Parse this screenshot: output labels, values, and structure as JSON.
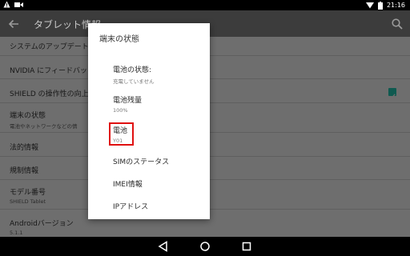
{
  "status_bar": {
    "time": "21:16",
    "icons": [
      "warning-icon",
      "media-icon",
      "wifi-icon",
      "battery-icon"
    ]
  },
  "app_bar": {
    "title": "タブレット情報"
  },
  "settings": {
    "items": [
      {
        "title": "システムのアップデート",
        "subtitle": ""
      },
      {
        "title": "NVIDIA にフィードバック",
        "subtitle": ""
      },
      {
        "title": "SHIELD の操作性の向上に",
        "subtitle": ""
      },
      {
        "title": "端末の状態",
        "subtitle": "電池やネットワークなどの情"
      },
      {
        "title": "法的情報",
        "subtitle": ""
      },
      {
        "title": "規制情報",
        "subtitle": ""
      },
      {
        "title": "モデル番号",
        "subtitle": "SHIELD Tablet"
      },
      {
        "title": "Androidバージョン",
        "subtitle": "5.1.1"
      }
    ],
    "checkbox_checked": true
  },
  "dialog": {
    "title": "端末の状態",
    "items": [
      {
        "label": "電池の状態:",
        "value": "充電していません"
      },
      {
        "label": "電池残量",
        "value": "100%"
      },
      {
        "label": "電池",
        "value": "Y01"
      },
      {
        "label": "SIMのステータス",
        "value": ""
      },
      {
        "label": "IMEI情報",
        "value": ""
      },
      {
        "label": "IPアドレス",
        "value": ""
      }
    ]
  },
  "nav_bar": {
    "icons": [
      "back-icon",
      "home-icon",
      "recents-icon"
    ]
  },
  "colors": {
    "accent": "#0f5a50",
    "highlight": "#e01010",
    "app_bar": "#3c3c3c",
    "scrim": "#6e6e6e"
  }
}
